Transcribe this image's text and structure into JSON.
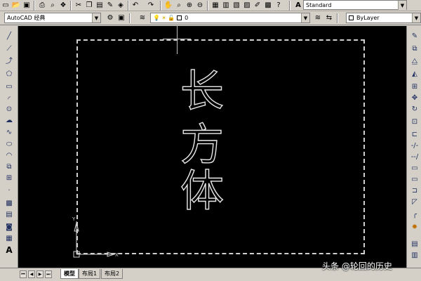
{
  "toolbar1": {
    "icons": [
      "new-icon",
      "open-icon",
      "save-icon",
      "plot-icon",
      "preview-icon",
      "publish-icon",
      "cut-icon",
      "copy-icon",
      "paste-icon",
      "match-icon",
      "block-editor-icon",
      "undo-icon",
      "redo-icon",
      "pan-icon",
      "zoom-realtime-icon",
      "zoom-window-icon",
      "zoom-previous-icon",
      "properties-icon",
      "design-center-icon",
      "tool-palettes-icon",
      "sheet-set-icon",
      "markup-icon",
      "calculator-icon",
      "help-icon",
      "text-style-icon"
    ],
    "text_style_value": "Standard"
  },
  "toolbar2": {
    "workspace_value": "AutoCAD 经典",
    "layer_value": "0",
    "linetype_value": "ByLayer"
  },
  "left_toolbar": {
    "icons": [
      "line-icon",
      "construction-line-icon",
      "polyline-icon",
      "polygon-icon",
      "rectangle-icon",
      "arc-icon",
      "circle-icon",
      "revision-cloud-icon",
      "spline-icon",
      "ellipse-icon",
      "ellipse-arc-icon",
      "insert-block-icon",
      "make-block-icon",
      "point-icon",
      "hatch-icon",
      "gradient-icon",
      "region-icon",
      "table-icon",
      "multiline-text-icon"
    ],
    "text_tool_glyph": "A"
  },
  "right_toolbar": {
    "icons": [
      "erase-icon",
      "copy-object-icon",
      "mirror-icon",
      "offset-icon",
      "array-icon",
      "move-icon",
      "rotate-icon",
      "scale-icon",
      "stretch-icon",
      "trim-icon",
      "extend-icon",
      "break-at-point-icon",
      "break-icon",
      "join-icon",
      "chamfer-icon",
      "fillet-icon",
      "explode-icon"
    ]
  },
  "canvas": {
    "characters": [
      "长",
      "方",
      "体"
    ],
    "ucs_y_label": "Y",
    "ucs_x_label": "X"
  },
  "tabs": [
    {
      "label": "模型",
      "active": true
    },
    {
      "label": "布局1",
      "active": false
    },
    {
      "label": "布局2",
      "active": false
    }
  ],
  "watermark": "头条 @轮回的历史"
}
